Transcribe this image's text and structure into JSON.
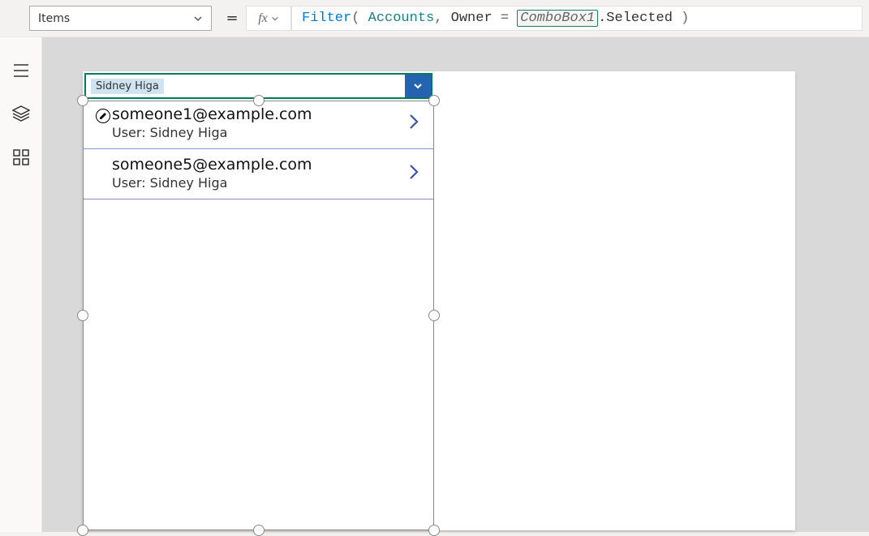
{
  "propertyDropdown": {
    "value": "Items"
  },
  "formulaBar": {
    "equals": "=",
    "fx": "fx"
  },
  "formula": {
    "fn": "Filter",
    "open": "(",
    "space": " ",
    "arg1": "Accounts",
    "comma": ",",
    "owner": "Owner",
    "eq": "=",
    "ref": "ComboBox1",
    "dotSelected": ".Selected",
    "close": ")"
  },
  "combobox": {
    "selected": "Sidney Higa"
  },
  "gallery": {
    "items": [
      {
        "title": "someone1@example.com",
        "subtitle": "User: Sidney Higa"
      },
      {
        "title": "someone5@example.com",
        "subtitle": "User: Sidney Higa"
      }
    ]
  }
}
